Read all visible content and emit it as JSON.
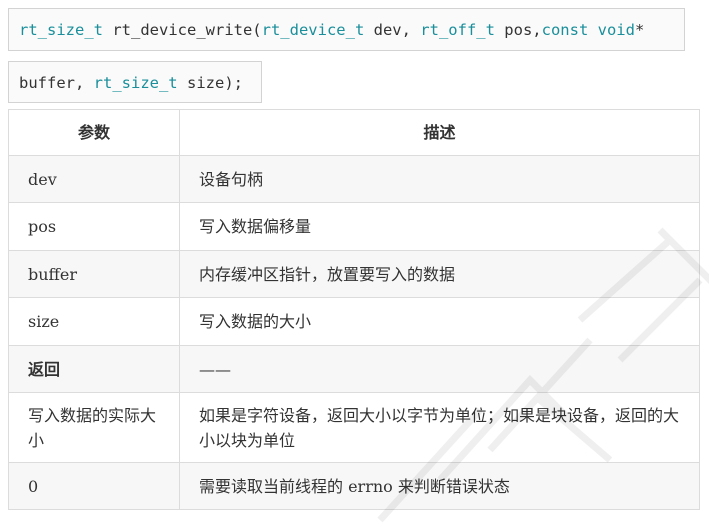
{
  "signature": {
    "line1": {
      "ret_type": "rt_size_t",
      "func_name": " rt_device_write(",
      "p1_type": "rt_device_t",
      "p1_name": " dev, ",
      "p2_type": "rt_off_t",
      "p2_name": " pos,",
      "p3_type": "const void",
      "p3_tail": "*"
    },
    "line2": {
      "p3_name": "buffer, ",
      "p4_type": "rt_size_t",
      "p4_name": " size);"
    }
  },
  "table": {
    "headers": [
      "参数",
      "描述"
    ],
    "rows": [
      {
        "param": "dev",
        "desc": "设备句柄"
      },
      {
        "param": "pos",
        "desc": "写入数据偏移量"
      },
      {
        "param": "buffer",
        "desc": "内存缓冲区指针，放置要写入的数据"
      },
      {
        "param": "size",
        "desc": "写入数据的大小"
      },
      {
        "param": "返回",
        "desc": "——"
      },
      {
        "param": "写入数据的实际大小",
        "desc": "如果是字符设备，返回大小以字节为单位；如果是块设备，返回的大小以块为单位"
      },
      {
        "param": "0",
        "desc": "需要读取当前线程的 errno 来判断错误状态"
      }
    ]
  },
  "colors": {
    "keyword": "#1a8f9b",
    "text": "#333333",
    "border": "#dcdcdc",
    "row_shade": "#f7f7f7"
  }
}
